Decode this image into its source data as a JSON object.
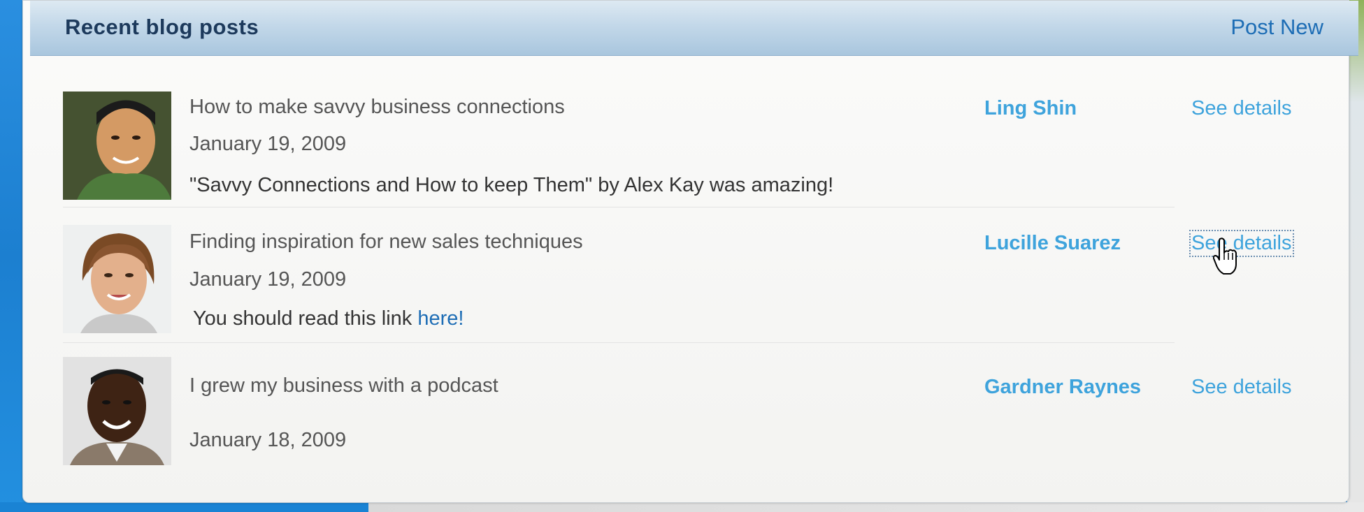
{
  "header": {
    "title": "Recent blog posts",
    "post_new_label": "Post New"
  },
  "posts": [
    {
      "title": "How to make savvy business connections",
      "date": "January 19, 2009",
      "text": "\"Savvy Connections and How to keep Them\" by Alex Kay was amazing!",
      "author": "Ling Shin",
      "details_label": "See details"
    },
    {
      "title": "Finding inspiration for new sales techniques",
      "date": "January 19, 2009",
      "text_prefix": "You should read this link ",
      "link_label": "here!",
      "author": "Lucille Suarez",
      "details_label": "See details"
    },
    {
      "title": "I grew my business with a podcast",
      "date": "January 18, 2009",
      "author": "Gardner Raynes",
      "details_label": "See details"
    }
  ],
  "icons": {
    "cursor": "hand-pointer-icon"
  },
  "colors": {
    "accent": "#3ea3dc",
    "link": "#1d6db5",
    "header_text": "#1d3a5c"
  }
}
